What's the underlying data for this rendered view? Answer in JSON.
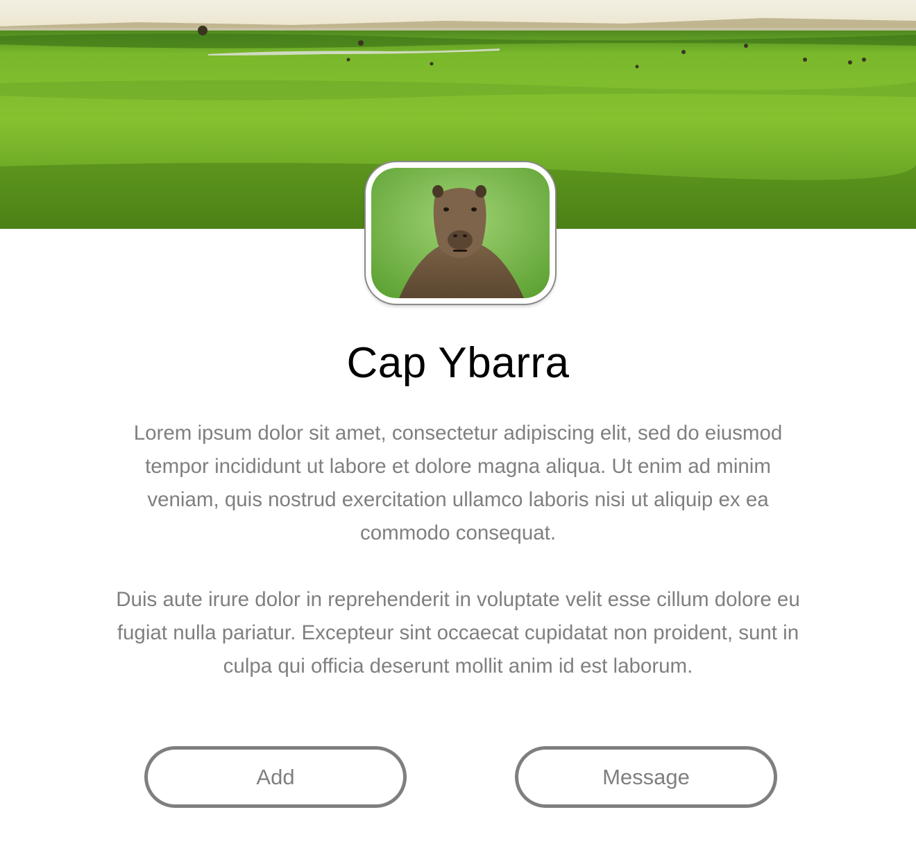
{
  "profile": {
    "cover_image": "grassland-landscape",
    "avatar_image": "capybara-portrait",
    "name": "Cap Ybarra",
    "bio": [
      "Lorem ipsum dolor sit amet, consectetur adipiscing elit, sed do eiusmod tempor incididunt ut labore et dolore magna aliqua. Ut enim ad minim veniam, quis nostrud exercitation ullamco laboris nisi ut aliquip ex ea commodo consequat.",
      "Duis aute irure dolor in reprehenderit in voluptate velit esse cillum dolore eu fugiat nulla pariatur. Excepteur sint occaecat cupidatat non proident, sunt in culpa qui officia deserunt mollit anim id est laborum."
    ]
  },
  "actions": {
    "add_label": "Add",
    "message_label": "Message"
  },
  "colors": {
    "text_muted": "#7f7f7f",
    "heading": "#000000",
    "button_border": "#7f7f7f",
    "grass": "#7cb82a"
  }
}
